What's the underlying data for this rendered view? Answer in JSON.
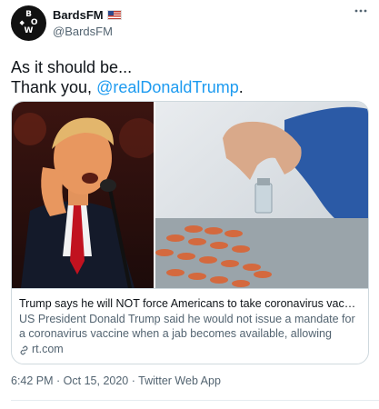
{
  "user": {
    "display_name": "BardsFM",
    "handle": "@BardsFM",
    "avatar_letters": [
      "B",
      "O",
      "W"
    ],
    "flag_icon": "us-flag-icon"
  },
  "menu_icon": "more-icon",
  "tweet": {
    "line1": "As it should be...",
    "line2_prefix": "Thank you, ",
    "mention": "@realDonaldTrump",
    "line2_suffix": "."
  },
  "card": {
    "title": "Trump says he will NOT force Americans to take coronavirus vacci...",
    "description": "US President Donald Trump said he would not issue a mandate for a coronavirus vaccine when a jab becomes available, allowing",
    "domain": "rt.com",
    "link_icon": "link-icon",
    "images": [
      "trump-speaking-photo",
      "vaccine-vial-photo"
    ]
  },
  "meta": {
    "time": "6:42 PM",
    "separator1": " · ",
    "date": "Oct 15, 2020",
    "separator2": " · ",
    "source": "Twitter Web App"
  },
  "colors": {
    "accent": "#1d9bf0",
    "text": "#0f1419",
    "secondary": "#536471",
    "border": "#cfd9de"
  }
}
